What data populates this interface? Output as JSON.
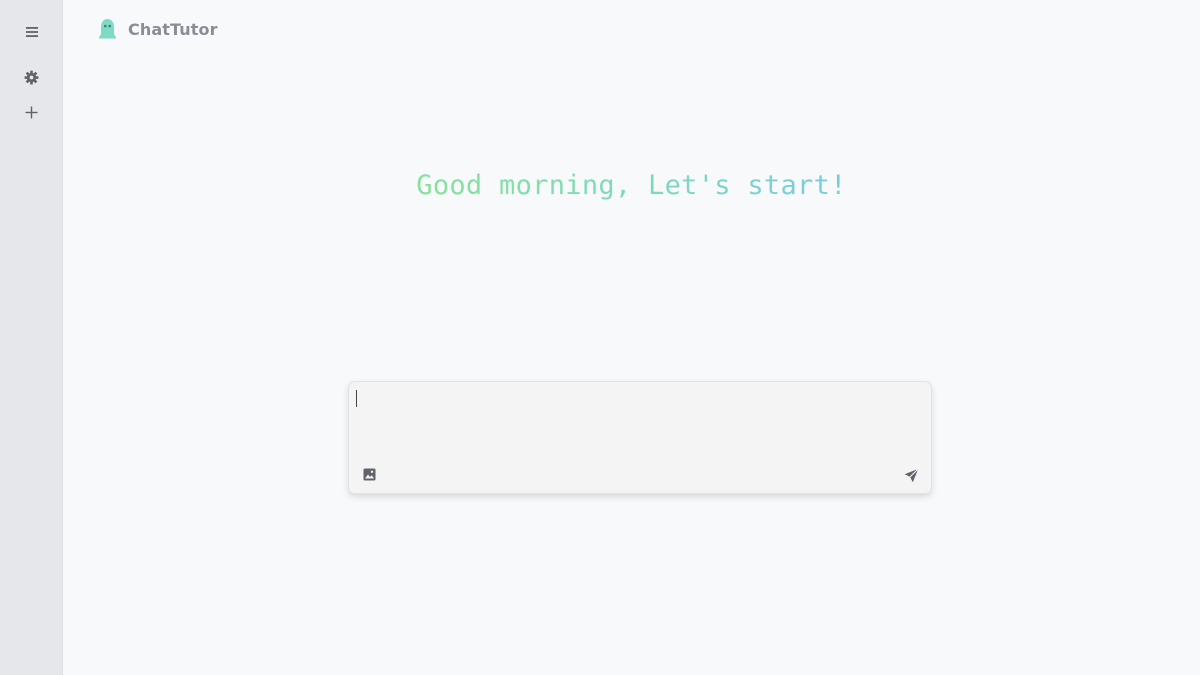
{
  "sidebar": {
    "items": [
      {
        "icon": "hamburger-menu-icon"
      },
      {
        "icon": "gear-icon"
      },
      {
        "icon": "plus-icon"
      }
    ]
  },
  "header": {
    "logo_icon": "ghost-logo-icon",
    "app_name": "ChatTutor"
  },
  "main": {
    "greeting": "Good morning, Let's start!"
  },
  "composer": {
    "value": "",
    "placeholder": "",
    "attach_icon": "image-icon",
    "send_icon": "send-icon"
  },
  "colors": {
    "sidebar_bg": "#e6e7ea",
    "page_bg": "#f8f9fb",
    "greeting_gradient_start": "#86e29a",
    "greeting_gradient_end": "#79cbdf",
    "logo": "#7ed9c5"
  }
}
